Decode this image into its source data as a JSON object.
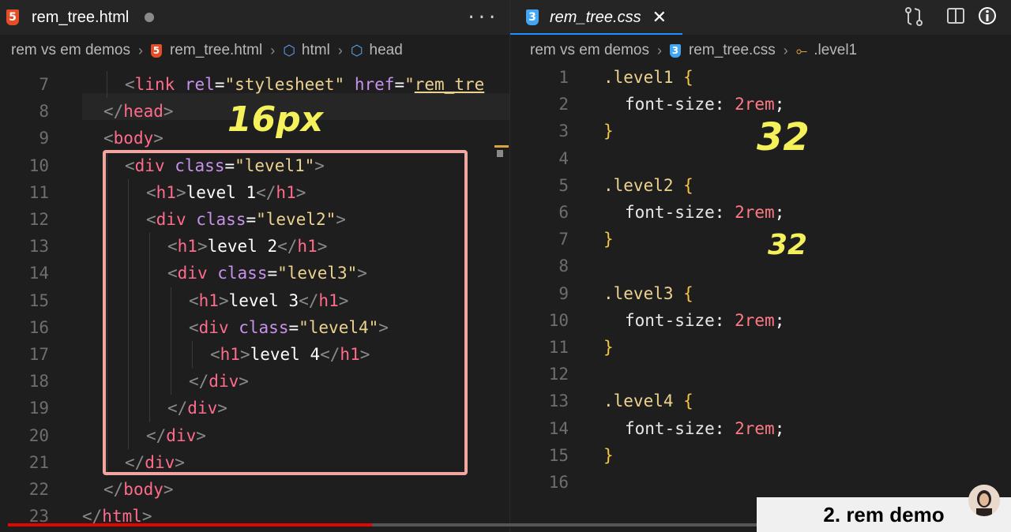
{
  "left_editor": {
    "tab": {
      "label": "rem_tree.html",
      "dirty": true
    },
    "more_actions": "···",
    "breadcrumb": [
      "rem vs em demos",
      "rem_tree.html",
      "html",
      "head"
    ],
    "handwritten_note": "16px",
    "lines": [
      {
        "n": "7",
        "indent": 2,
        "tokens": [
          [
            "punc",
            "<"
          ],
          [
            "tag",
            "link"
          ],
          [
            "text",
            " "
          ],
          [
            "attr",
            "rel"
          ],
          [
            "eq",
            "="
          ],
          [
            "str",
            "\"stylesheet\""
          ],
          [
            "text",
            " "
          ],
          [
            "attr",
            "href"
          ],
          [
            "eq",
            "="
          ],
          [
            "str",
            "\""
          ],
          [
            "link",
            "rem_tre"
          ]
        ]
      },
      {
        "n": "8",
        "indent": 1,
        "tokens": [
          [
            "punc",
            "</"
          ],
          [
            "tag",
            "head"
          ],
          [
            "punc",
            ">"
          ]
        ]
      },
      {
        "n": "9",
        "indent": 1,
        "tokens": [
          [
            "punc",
            "<"
          ],
          [
            "tag",
            "body"
          ],
          [
            "punc",
            ">"
          ]
        ]
      },
      {
        "n": "10",
        "indent": 2,
        "tokens": [
          [
            "punc",
            "<"
          ],
          [
            "tag",
            "div"
          ],
          [
            "text",
            " "
          ],
          [
            "attr",
            "class"
          ],
          [
            "eq",
            "="
          ],
          [
            "str",
            "\"level1\""
          ],
          [
            "punc",
            ">"
          ]
        ]
      },
      {
        "n": "11",
        "indent": 3,
        "tokens": [
          [
            "punc",
            "<"
          ],
          [
            "tag",
            "h1"
          ],
          [
            "punc",
            ">"
          ],
          [
            "text",
            "level 1"
          ],
          [
            "punc",
            "</"
          ],
          [
            "tag",
            "h1"
          ],
          [
            "punc",
            ">"
          ]
        ]
      },
      {
        "n": "12",
        "indent": 3,
        "tokens": [
          [
            "punc",
            "<"
          ],
          [
            "tag",
            "div"
          ],
          [
            "text",
            " "
          ],
          [
            "attr",
            "class"
          ],
          [
            "eq",
            "="
          ],
          [
            "str",
            "\"level2\""
          ],
          [
            "punc",
            ">"
          ]
        ]
      },
      {
        "n": "13",
        "indent": 4,
        "tokens": [
          [
            "punc",
            "<"
          ],
          [
            "tag",
            "h1"
          ],
          [
            "punc",
            ">"
          ],
          [
            "text",
            "level 2"
          ],
          [
            "punc",
            "</"
          ],
          [
            "tag",
            "h1"
          ],
          [
            "punc",
            ">"
          ]
        ]
      },
      {
        "n": "14",
        "indent": 4,
        "tokens": [
          [
            "punc",
            "<"
          ],
          [
            "tag",
            "div"
          ],
          [
            "text",
            " "
          ],
          [
            "attr",
            "class"
          ],
          [
            "eq",
            "="
          ],
          [
            "str",
            "\"level3\""
          ],
          [
            "punc",
            ">"
          ]
        ]
      },
      {
        "n": "15",
        "indent": 5,
        "tokens": [
          [
            "punc",
            "<"
          ],
          [
            "tag",
            "h1"
          ],
          [
            "punc",
            ">"
          ],
          [
            "text",
            "level 3"
          ],
          [
            "punc",
            "</"
          ],
          [
            "tag",
            "h1"
          ],
          [
            "punc",
            ">"
          ]
        ]
      },
      {
        "n": "16",
        "indent": 5,
        "tokens": [
          [
            "punc",
            "<"
          ],
          [
            "tag",
            "div"
          ],
          [
            "text",
            " "
          ],
          [
            "attr",
            "class"
          ],
          [
            "eq",
            "="
          ],
          [
            "str",
            "\"level4\""
          ],
          [
            "punc",
            ">"
          ]
        ]
      },
      {
        "n": "17",
        "indent": 6,
        "tokens": [
          [
            "punc",
            "<"
          ],
          [
            "tag",
            "h1"
          ],
          [
            "punc",
            ">"
          ],
          [
            "text",
            "level 4"
          ],
          [
            "punc",
            "</"
          ],
          [
            "tag",
            "h1"
          ],
          [
            "punc",
            ">"
          ]
        ]
      },
      {
        "n": "18",
        "indent": 5,
        "tokens": [
          [
            "punc",
            "</"
          ],
          [
            "tag",
            "div"
          ],
          [
            "punc",
            ">"
          ]
        ]
      },
      {
        "n": "19",
        "indent": 4,
        "tokens": [
          [
            "punc",
            "</"
          ],
          [
            "tag",
            "div"
          ],
          [
            "punc",
            ">"
          ]
        ]
      },
      {
        "n": "20",
        "indent": 3,
        "tokens": [
          [
            "punc",
            "</"
          ],
          [
            "tag",
            "div"
          ],
          [
            "punc",
            ">"
          ]
        ]
      },
      {
        "n": "21",
        "indent": 2,
        "tokens": [
          [
            "punc",
            "</"
          ],
          [
            "tag",
            "div"
          ],
          [
            "punc",
            ">"
          ]
        ]
      },
      {
        "n": "22",
        "indent": 1,
        "tokens": [
          [
            "punc",
            "</"
          ],
          [
            "tag",
            "body"
          ],
          [
            "punc",
            ">"
          ]
        ]
      },
      {
        "n": "23",
        "indent": 0,
        "tokens": [
          [
            "punc",
            "</"
          ],
          [
            "tag",
            "html"
          ],
          [
            "punc",
            ">"
          ]
        ]
      }
    ]
  },
  "right_editor": {
    "tab": {
      "label": "rem_tree.css",
      "close": "✕"
    },
    "breadcrumb": [
      "rem vs em demos",
      "rem_tree.css",
      ".level1"
    ],
    "handwritten_notes": [
      "32",
      "32"
    ],
    "lines": [
      {
        "n": "1",
        "indent": 0,
        "tokens": [
          [
            "sel",
            ".level1"
          ],
          [
            "text",
            " "
          ],
          [
            "brace",
            "{"
          ]
        ]
      },
      {
        "n": "2",
        "indent": 1,
        "tokens": [
          [
            "prop",
            "font-size"
          ],
          [
            "colon",
            ":"
          ],
          [
            "text",
            " "
          ],
          [
            "val",
            "2rem"
          ],
          [
            "semi",
            ";"
          ]
        ]
      },
      {
        "n": "3",
        "indent": 0,
        "tokens": [
          [
            "brace",
            "}"
          ]
        ]
      },
      {
        "n": "4",
        "indent": 0,
        "tokens": []
      },
      {
        "n": "5",
        "indent": 0,
        "tokens": [
          [
            "sel",
            ".level2"
          ],
          [
            "text",
            " "
          ],
          [
            "brace",
            "{"
          ]
        ]
      },
      {
        "n": "6",
        "indent": 1,
        "tokens": [
          [
            "prop",
            "font-size"
          ],
          [
            "colon",
            ":"
          ],
          [
            "text",
            " "
          ],
          [
            "val",
            "2rem"
          ],
          [
            "semi",
            ";"
          ]
        ]
      },
      {
        "n": "7",
        "indent": 0,
        "tokens": [
          [
            "brace",
            "}"
          ]
        ]
      },
      {
        "n": "8",
        "indent": 0,
        "tokens": []
      },
      {
        "n": "9",
        "indent": 0,
        "tokens": [
          [
            "sel",
            ".level3"
          ],
          [
            "text",
            " "
          ],
          [
            "brace",
            "{"
          ]
        ]
      },
      {
        "n": "10",
        "indent": 1,
        "tokens": [
          [
            "prop",
            "font-size"
          ],
          [
            "colon",
            ":"
          ],
          [
            "text",
            " "
          ],
          [
            "val",
            "2rem"
          ],
          [
            "semi",
            ";"
          ]
        ]
      },
      {
        "n": "11",
        "indent": 0,
        "tokens": [
          [
            "brace",
            "}"
          ]
        ]
      },
      {
        "n": "12",
        "indent": 0,
        "tokens": []
      },
      {
        "n": "13",
        "indent": 0,
        "tokens": [
          [
            "sel",
            ".level4"
          ],
          [
            "text",
            " "
          ],
          [
            "brace",
            "{"
          ]
        ]
      },
      {
        "n": "14",
        "indent": 1,
        "tokens": [
          [
            "prop",
            "font-size"
          ],
          [
            "colon",
            ":"
          ],
          [
            "text",
            " "
          ],
          [
            "val",
            "2rem"
          ],
          [
            "semi",
            ";"
          ]
        ]
      },
      {
        "n": "15",
        "indent": 0,
        "tokens": [
          [
            "brace",
            "}"
          ]
        ]
      },
      {
        "n": "16",
        "indent": 0,
        "tokens": []
      }
    ]
  },
  "video": {
    "caption": "2. rem demo",
    "progress_fraction": 0.366
  }
}
